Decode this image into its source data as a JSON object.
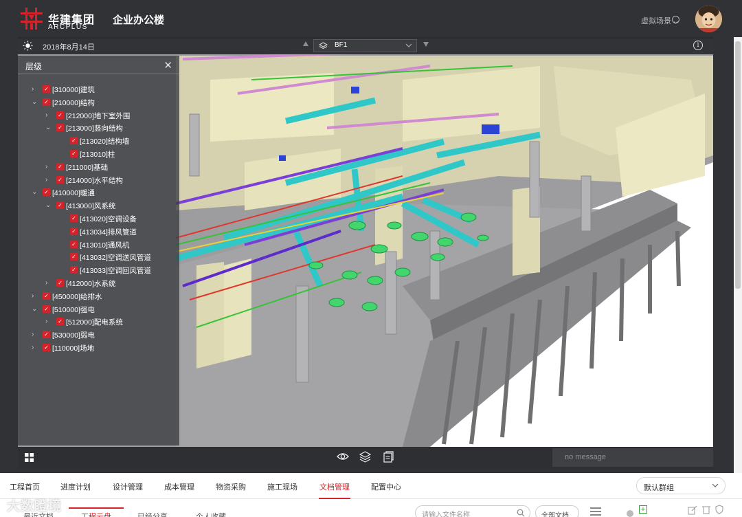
{
  "header": {
    "brand_cn": "华建集团",
    "brand_en": "ARCPLUS",
    "project_title": "企业办公楼",
    "virtual_scene": "虚拟场景",
    "brand_color": "#d5232b"
  },
  "viewer": {
    "date": "2018年8月14日",
    "floor": "BF1",
    "message_placeholder": "no message"
  },
  "layer_panel": {
    "title": "层级",
    "items": [
      {
        "label": "[310000]建筑",
        "level": 0,
        "expanded": false
      },
      {
        "label": "[210000]结构",
        "level": 0,
        "expanded": true
      },
      {
        "label": "[212000]地下室外围",
        "level": 1,
        "expanded": false
      },
      {
        "label": "[213000]竖向结构",
        "level": 1,
        "expanded": true
      },
      {
        "label": "[213020]结构墙",
        "level": 2,
        "expanded": null
      },
      {
        "label": "[213010]柱",
        "level": 2,
        "expanded": null
      },
      {
        "label": "[211000]基础",
        "level": 1,
        "expanded": false
      },
      {
        "label": "[214000]水平结构",
        "level": 1,
        "expanded": false
      },
      {
        "label": "[410000]暖通",
        "level": 0,
        "expanded": true
      },
      {
        "label": "[413000]风系统",
        "level": 1,
        "expanded": true
      },
      {
        "label": "[413020]空调设备",
        "level": 2,
        "expanded": null
      },
      {
        "label": "[413034]排风管道",
        "level": 2,
        "expanded": null
      },
      {
        "label": "[413010]通风机",
        "level": 2,
        "expanded": null
      },
      {
        "label": "[413032]空调送风管道",
        "level": 2,
        "expanded": null
      },
      {
        "label": "[413033]空调回风管道",
        "level": 2,
        "expanded": null
      },
      {
        "label": "[412000]水系统",
        "level": 1,
        "expanded": false
      },
      {
        "label": "[450000]给排水",
        "level": 0,
        "expanded": false
      },
      {
        "label": "[510000]强电",
        "level": 0,
        "expanded": true
      },
      {
        "label": "[512000]配电系统",
        "level": 1,
        "expanded": false
      },
      {
        "label": "[530000]弱电",
        "level": 0,
        "expanded": false
      },
      {
        "label": "[110000]场地",
        "level": 0,
        "expanded": false
      }
    ]
  },
  "nav": {
    "items": [
      "工程首页",
      "进度计划",
      "设计管理",
      "成本管理",
      "物资采购",
      "施工现场",
      "文档管理",
      "配置中心"
    ],
    "active_index": 6,
    "group_select": "默认群组"
  },
  "subnav": {
    "items": [
      "最近文档",
      "工程云盘",
      "已经分享",
      "个人收藏"
    ],
    "active_index": 1,
    "search_placeholder": "请输入文件名称",
    "filter": "全部文档"
  },
  "watermark": "大数瞪境"
}
